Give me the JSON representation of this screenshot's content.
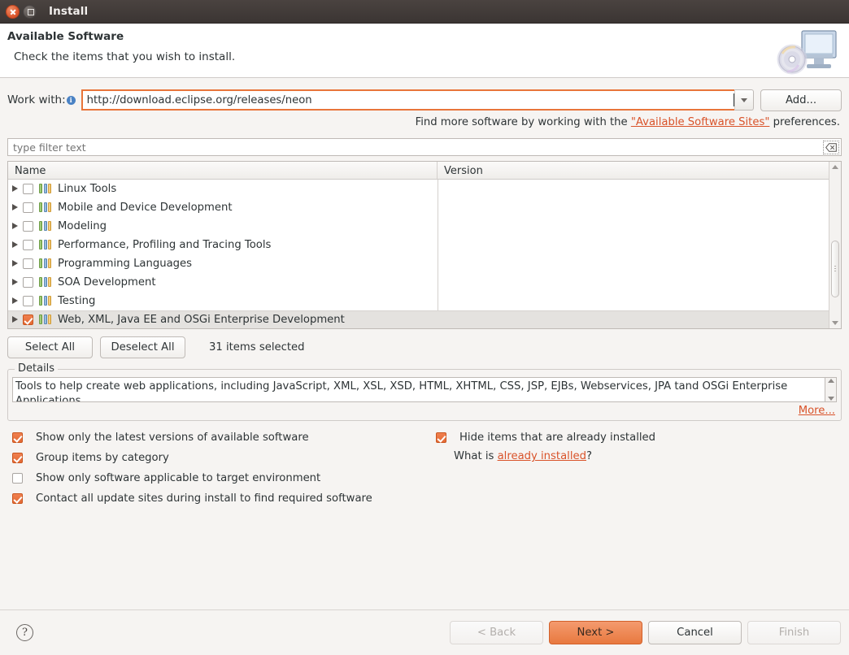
{
  "window": {
    "title": "Install",
    "close_icon": "close-icon",
    "maximize_icon": "maximize-icon"
  },
  "banner": {
    "title": "Available Software",
    "subtitle": "Check the items that you wish to install.",
    "icon": "computer-disc-icon"
  },
  "work_with": {
    "label": "Work with:",
    "info_icon": "info-icon",
    "value": "http://download.eclipse.org/releases/neon",
    "dropdown_icon": "chevron-down-icon",
    "add_button": "Add...",
    "hint_prefix": "Find more software by working with the ",
    "hint_link": "\"Available Software Sites\"",
    "hint_suffix": " preferences."
  },
  "filter": {
    "placeholder": "type filter text",
    "value": "",
    "clear_icon": "clear-icon"
  },
  "table": {
    "columns": [
      "Name",
      "Version"
    ],
    "rows": [
      {
        "name": "Linux Tools",
        "version": "",
        "checked": false,
        "selected": false
      },
      {
        "name": "Mobile and Device Development",
        "version": "",
        "checked": false,
        "selected": false
      },
      {
        "name": "Modeling",
        "version": "",
        "checked": false,
        "selected": false
      },
      {
        "name": "Performance, Profiling and Tracing Tools",
        "version": "",
        "checked": false,
        "selected": false
      },
      {
        "name": "Programming Languages",
        "version": "",
        "checked": false,
        "selected": false
      },
      {
        "name": "SOA Development",
        "version": "",
        "checked": false,
        "selected": false
      },
      {
        "name": "Testing",
        "version": "",
        "checked": false,
        "selected": false
      },
      {
        "name": "Web, XML, Java EE and OSGi Enterprise Development",
        "version": "",
        "checked": true,
        "selected": true
      }
    ]
  },
  "selection": {
    "select_all": "Select All",
    "deselect_all": "Deselect All",
    "status": "31 items selected"
  },
  "details": {
    "legend": "Details",
    "text_line1": "Tools to help create web applications, including JavaScript, XML, XSL, XSD, HTML, XHTML, CSS, JSP, EJBs, Webservices, JPA tand OSGi Enterprise",
    "text_line2": "Applications",
    "more_link": "More..."
  },
  "options": {
    "left": [
      {
        "label": "Show only the latest versions of available software",
        "checked": true
      },
      {
        "label": "Group items by category",
        "checked": true
      },
      {
        "label": "Show only software applicable to target environment",
        "checked": false
      },
      {
        "label": "Contact all update sites during install to find required software",
        "checked": true
      }
    ],
    "right": [
      {
        "label": "Hide items that are already installed",
        "checked": true
      }
    ],
    "what_is_prefix": "What is ",
    "what_is_link": "already installed",
    "what_is_suffix": "?"
  },
  "footer": {
    "help_icon": "help-icon",
    "help_glyph": "?",
    "back": "< Back",
    "next": "Next >",
    "cancel": "Cancel",
    "finish": "Finish"
  },
  "colors": {
    "accent": "#e8753a",
    "link": "#d9532a",
    "titlebar": "#3b3533",
    "selected_row": "#e4e2df"
  }
}
